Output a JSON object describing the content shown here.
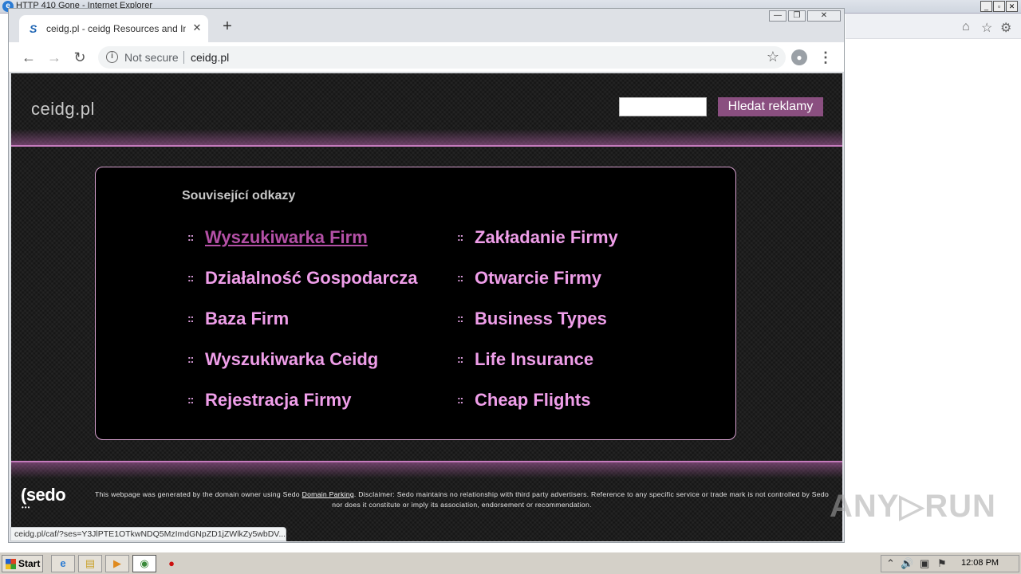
{
  "ie": {
    "title": "HTTP 410 Gone - Internet Explorer",
    "logo_glyph": "e",
    "min_glyph": "_",
    "max_glyph": "▫",
    "close_glyph": "✕",
    "home_glyph": "⌂",
    "favorites_glyph": "☆",
    "tools_glyph": "⚙"
  },
  "chrome": {
    "tab_favicon": "S",
    "tab_title": "ceidg.pl - ceidg Resources and Information.",
    "tab_close_glyph": "✕",
    "new_tab_glyph": "+",
    "minimize_glyph": "—",
    "restore_glyph": "❐",
    "close_glyph": "✕",
    "back_glyph": "←",
    "forward_glyph": "→",
    "reload_glyph": "↻",
    "info_glyph": "i",
    "security_label": "Not secure",
    "url": "ceidg.pl",
    "star_glyph": "☆",
    "profile_glyph": "●",
    "menu_glyph": "⋮",
    "status_url": "ceidg.pl/caf/?ses=Y3JlPTE1OTkwNDQ5MzImdGNpZD1jZWlkZy5wbDV..."
  },
  "site": {
    "logo": "ceidg.pl",
    "search_placeholder": "",
    "search_button": "Hledat reklamy",
    "heading": "Související odkazy",
    "bullet": "::",
    "links_left": [
      "Wyszukiwarka Firm",
      "Działalność Gospodarcza",
      "Baza Firm",
      "Wyszukiwarka Ceidg",
      "Rejestracja Firmy"
    ],
    "links_right": [
      "Zakładanie Firmy",
      "Otwarcie Firmy",
      "Business Types",
      "Life Insurance",
      "Cheap Flights"
    ],
    "footer_logo": "(sedo",
    "footer_dots": "•••",
    "disclaimer_pre": "This webpage was generated by the domain owner using Sedo ",
    "disclaimer_link": "Domain Parking",
    "disclaimer_post": ". Disclaimer: Sedo maintains no relationship with third party advertisers. Reference to any specific service or trade mark is not controlled by Sedo nor does it constitute or imply its association, endorsement or recommendation."
  },
  "watermark": "ANY▷RUN",
  "taskbar": {
    "start_label": "Start",
    "apps": [
      "e",
      "▤",
      "▶",
      "◉",
      "●"
    ],
    "tray_icons": [
      "⌃",
      "🔊",
      "▣",
      "⚑"
    ],
    "clock": "12:08 PM"
  },
  "colors": {
    "accent_pink": "#ef9ee9",
    "visited_link": "#b450a6",
    "search_button_bg": "#8a4f80"
  }
}
